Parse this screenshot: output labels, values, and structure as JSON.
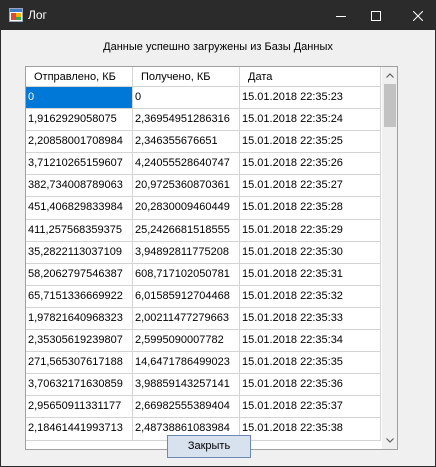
{
  "window": {
    "title": "Лог"
  },
  "status_message": "Данные успешно загружены из Базы Данных",
  "table": {
    "columns": [
      "Отправлено, КБ",
      "Получено, КБ",
      "Дата"
    ],
    "rows": [
      [
        "0",
        "0",
        "15.01.2018 22:35:23"
      ],
      [
        "1,9162929058075",
        "2,3695495128631­6",
        "15.01.2018 22:35:24"
      ],
      [
        "2,20858001708984",
        "2,346355676651",
        "15.01.2018 22:35:25"
      ],
      [
        "3,71210265159607",
        "4,24055528640747",
        "15.01.2018 22:35:26"
      ],
      [
        "382,734008789063",
        "20,9725360870361",
        "15.01.2018 22:35:27"
      ],
      [
        "451,406829833984",
        "20,2830009460449",
        "15.01.2018 22:35:28"
      ],
      [
        "411,257568359375",
        "25,2426681518555",
        "15.01.2018 22:35:29"
      ],
      [
        "35,2822113037109",
        "3,94892811775208",
        "15.01.2018 22:35:30"
      ],
      [
        "58,2062797546387",
        "608,717102050781",
        "15.01.2018 22:35:31"
      ],
      [
        "65,7151336669922",
        "6,01585912704468",
        "15.01.2018 22:35:32"
      ],
      [
        "1,97821640968323",
        "2,00211477279663",
        "15.01.2018 22:35:33"
      ],
      [
        "2,35305619239807",
        "2,5995090007782",
        "15.01.2018 22:35:34"
      ],
      [
        "271,565307617188",
        "14,6471786499023",
        "15.01.2018 22:35:35"
      ],
      [
        "3,70632171630859",
        "3,98859143257141",
        "15.01.2018 22:35:36"
      ],
      [
        "2,95650911331177",
        "2,66982555389404",
        "15.01.2018 22:35:37"
      ],
      [
        "2,18461441993713",
        "2,48738861083984",
        "15.01.2018 22:35:38"
      ]
    ],
    "selected_row": 0
  },
  "buttons": {
    "close_label": "Закрыть"
  },
  "colors": {
    "titlebar": "#2b2b2b",
    "selection": "#0078d7",
    "button_face": "#d8e1ee",
    "button_border": "#6d87b8"
  },
  "icons": {
    "app": "app-window-icon",
    "minimize": "minimize-icon",
    "maximize": "maximize-icon",
    "close": "close-icon",
    "scroll_up": "chevron-up-icon",
    "scroll_down": "chevron-down-icon"
  }
}
